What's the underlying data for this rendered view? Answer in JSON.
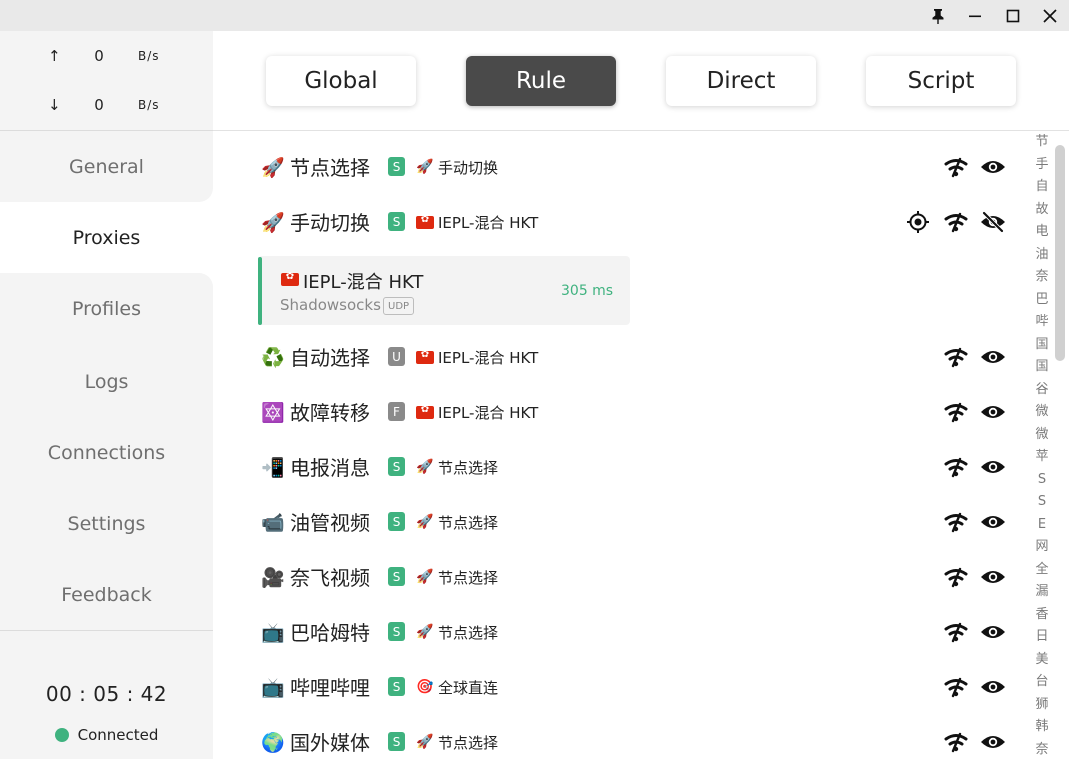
{
  "titlebar": {
    "pin_icon": "pin-icon",
    "minimize_icon": "minimize-icon",
    "maximize_icon": "maximize-icon",
    "close_icon": "close-icon"
  },
  "traffic": {
    "up_arrow": "↑",
    "up_value": "0",
    "up_unit": "B/s",
    "down_arrow": "↓",
    "down_value": "0",
    "down_unit": "B/s"
  },
  "nav": {
    "items": [
      {
        "label": "General"
      },
      {
        "label": "Proxies"
      },
      {
        "label": "Profiles"
      },
      {
        "label": "Logs"
      },
      {
        "label": "Connections"
      },
      {
        "label": "Settings"
      },
      {
        "label": "Feedback"
      }
    ],
    "active": "Proxies"
  },
  "footer": {
    "uptime": "00 : 05 : 42",
    "status": "Connected",
    "status_color": "#3fb27f"
  },
  "modes": {
    "items": [
      "Global",
      "Rule",
      "Direct",
      "Script"
    ],
    "active": "Rule"
  },
  "groups": [
    {
      "emoji": "🚀",
      "name": "节点选择",
      "badge": "S",
      "selected_emoji": "🚀",
      "selected": "手动切换"
    },
    {
      "emoji": "🚀",
      "name": "手动切换",
      "badge": "S",
      "selected_emoji": "flag-hk",
      "selected": "IEPL-混合 HKT"
    },
    {
      "emoji": "♻️",
      "name": "自动选择",
      "badge": "U",
      "selected_emoji": "flag-hk",
      "selected": "IEPL-混合 HKT"
    },
    {
      "emoji": "🔯",
      "name": "故障转移",
      "badge": "F",
      "selected_emoji": "flag-hk",
      "selected": "IEPL-混合 HKT"
    },
    {
      "emoji": "📲",
      "name": "电报消息",
      "badge": "S",
      "selected_emoji": "🚀",
      "selected": "节点选择"
    },
    {
      "emoji": "📹",
      "name": "油管视频",
      "badge": "S",
      "selected_emoji": "🚀",
      "selected": "节点选择"
    },
    {
      "emoji": "🎥",
      "name": "奈飞视频",
      "badge": "S",
      "selected_emoji": "🚀",
      "selected": "节点选择"
    },
    {
      "emoji": "📺",
      "name": "巴哈姆特",
      "badge": "S",
      "selected_emoji": "🚀",
      "selected": "节点选择"
    },
    {
      "emoji": "📺",
      "name": "哔哩哔哩",
      "badge": "S",
      "selected_emoji": "🎯",
      "selected": "全球直连"
    },
    {
      "emoji": "🌍",
      "name": "国外媒体",
      "badge": "S",
      "selected_emoji": "🚀",
      "selected": "节点选择"
    }
  ],
  "expanded_node": {
    "name": "IEPL-混合 HKT",
    "type": "Shadowsocks",
    "udp": "UDP",
    "delay": "305 ms"
  },
  "index": [
    "节",
    "手",
    "自",
    "故",
    "电",
    "油",
    "奈",
    "巴",
    "哔",
    "国",
    "国",
    "谷",
    "微",
    "微",
    "苹",
    "S",
    "S",
    "E",
    "网",
    "全",
    "漏",
    "香",
    "日",
    "美",
    "台",
    "狮",
    "韩",
    "奈"
  ]
}
